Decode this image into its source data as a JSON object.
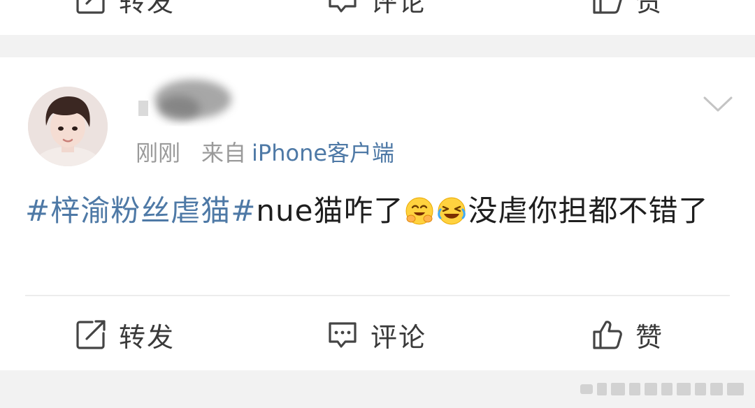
{
  "previous_post": {
    "actions": {
      "repost_label": "转发",
      "comment_label": "评论",
      "like_label": "赞"
    }
  },
  "post": {
    "time": "刚刚",
    "source_prefix": "来自",
    "source_client": "iPhone客户端",
    "hashtag": "#梓渝粉丝虐猫#",
    "text_before_emoji": "nue猫咋了",
    "text_after_emoji": "没虐你担都不错了",
    "emojis": [
      "hugging-face-emoji",
      "rolling-laughing-emoji"
    ],
    "actions": {
      "repost_label": "转发",
      "comment_label": "评论",
      "like_label": "赞"
    }
  },
  "colors": {
    "link": "#4e79a6",
    "text": "#1e1e1e",
    "meta": "#9a9a9a",
    "background": "#f2f2f2"
  }
}
